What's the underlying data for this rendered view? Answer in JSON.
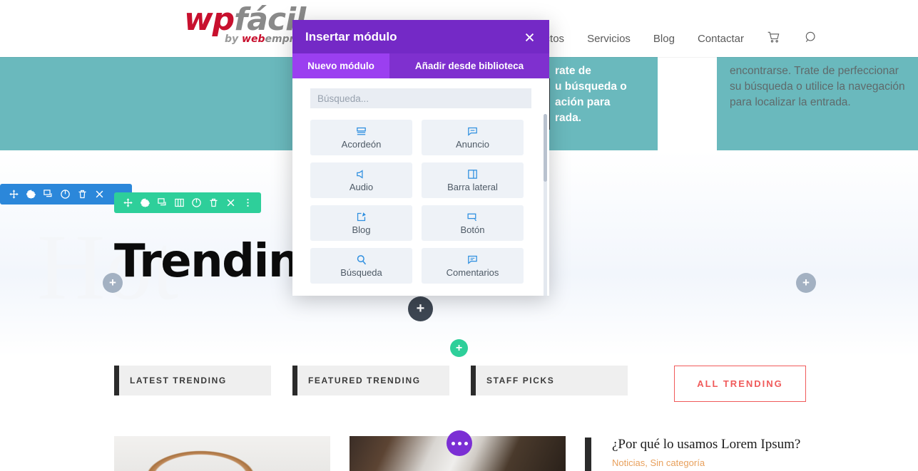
{
  "header": {
    "logo": {
      "main_wp": "wp",
      "main_facil": "fácil",
      "sub_by": "by ",
      "sub_web": "web",
      "sub_empr": "empr"
    },
    "nav": [
      {
        "label": "oductos"
      },
      {
        "label": "Servicios"
      },
      {
        "label": "Blog"
      },
      {
        "label": "Contactar"
      }
    ],
    "icons": {
      "cart": "cart-icon",
      "search": "search-icon"
    }
  },
  "content": {
    "teal_left_text": "rate de\nu búsqueda o\nación para\nrada.",
    "teal_right_text": "encontrarse. Trate de perfeccionar su búsqueda o utilice la navegación para localizar la entrada.",
    "hero_watermark": "Hot",
    "hero_title": "Trendin",
    "tabs": [
      {
        "label": "LATEST TRENDING"
      },
      {
        "label": "FEATURED TRENDING"
      },
      {
        "label": "STAFF PICKS"
      }
    ],
    "all_trending_button": "ALL TRENDING",
    "post": {
      "title": "¿Por qué lo usamos Lorem Ipsum?",
      "meta": "Noticias, Sin categoría"
    }
  },
  "builder": {
    "section_toolbar_icons": [
      "move-icon",
      "gear-icon",
      "duplicate-icon",
      "power-icon",
      "trash-icon",
      "close-icon"
    ],
    "row_toolbar_icons": [
      "move-icon",
      "gear-icon",
      "duplicate-icon",
      "columns-icon",
      "power-icon",
      "trash-icon",
      "close-icon",
      "kebab-icon"
    ],
    "add_buttons": {
      "plus": "+",
      "dots": "…"
    },
    "colors": {
      "section_toolbar": "#2b87da",
      "row_toolbar": "#2ecf9a",
      "module_dots": "#7b2fd4",
      "add_dark": "#3e4753",
      "add_gray": "#a3b1c2"
    }
  },
  "modal": {
    "title": "Insertar módulo",
    "close_label": "×",
    "tabs": [
      {
        "label": "Nuevo módulo",
        "active": true
      },
      {
        "label": "Añadir desde biblioteca",
        "active": false
      }
    ],
    "search": {
      "value": "",
      "placeholder": "Búsqueda..."
    },
    "modules": [
      {
        "label": "Acordeón",
        "icon": "accordion-icon"
      },
      {
        "label": "Anuncio",
        "icon": "announcement-icon"
      },
      {
        "label": "Audio",
        "icon": "audio-icon"
      },
      {
        "label": "Barra lateral",
        "icon": "sidebar-icon"
      },
      {
        "label": "Blog",
        "icon": "blog-icon"
      },
      {
        "label": "Botón",
        "icon": "button-icon"
      },
      {
        "label": "Búsqueda",
        "icon": "search-icon"
      },
      {
        "label": "Comentarios",
        "icon": "comments-icon"
      }
    ],
    "colors": {
      "header": "#7429c6",
      "tab_active": "#9b3ff0",
      "tab_inactive": "#7f30cf",
      "icon": "#2e8fe0"
    }
  }
}
